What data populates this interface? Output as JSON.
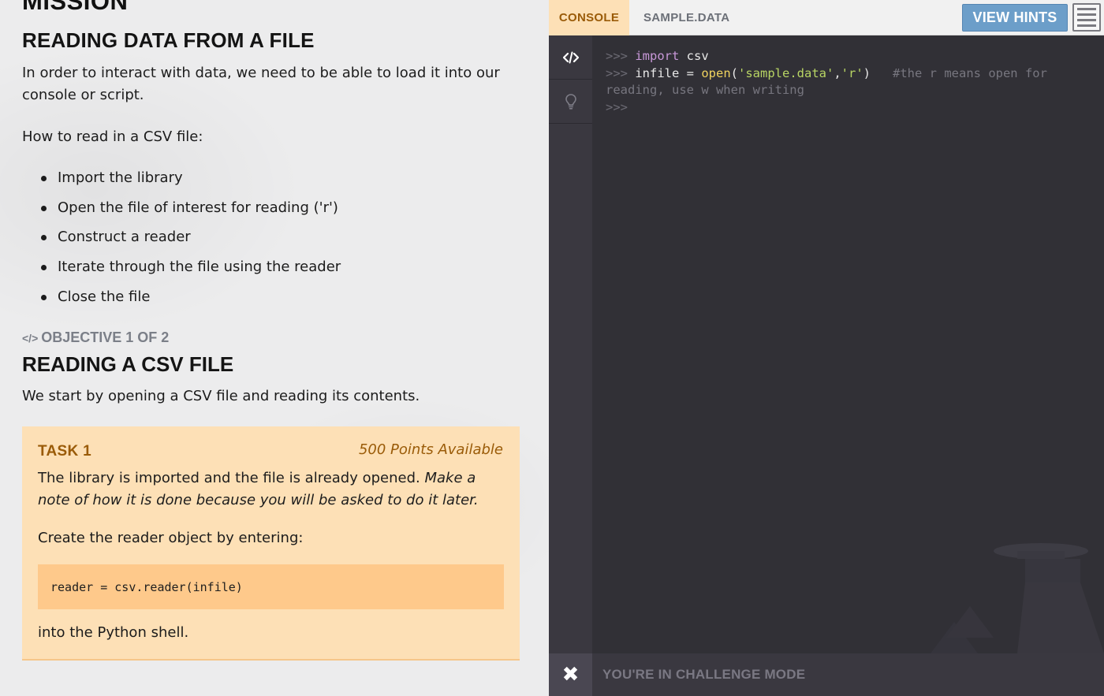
{
  "mission": {
    "heading": "MISSION",
    "section_title": "READING DATA FROM A FILE",
    "intro": "In order to interact with data, we need to be able to load it into our console or script.",
    "howto": "How to read in a CSV file:",
    "steps": [
      "Import the library",
      "Open the file of interest for reading ('r')",
      "Construct a reader",
      "Iterate through the file using the reader",
      "Close the file"
    ],
    "objective": {
      "label": "OBJECTIVE 1 OF 2",
      "title": "READING A CSV FILE",
      "description": "We start by opening a CSV file and reading its contents."
    },
    "task": {
      "label": "TASK 1",
      "points": "500 Points Available",
      "text_plain": "The library is imported and the file is already opened. ",
      "text_italic": "Make a note of how it is done because you will be asked to do it later.",
      "instruction": "Create the reader object by entering:",
      "code": "reader = csv.reader(infile)",
      "after": "into the Python shell."
    }
  },
  "editor": {
    "tabs": {
      "console": "CONSOLE",
      "sample": "SAMPLE.DATA"
    },
    "hints_label": "VIEW HINTS",
    "console_lines": {
      "line1_prompt": ">>> ",
      "line1_kw": "import",
      "line1_rest": " csv",
      "line2_prompt": ">>> ",
      "line2_a": "infile = ",
      "line2_fn": "open",
      "line2_b": "(",
      "line2_s1": "'sample.data'",
      "line2_c": ",",
      "line2_s2": "'r'",
      "line2_d": ")   ",
      "line2_comment": "#the r means open for reading, use w when writing",
      "line3_prompt": ">>>"
    },
    "challenge_text": "YOU'RE IN CHALLENGE MODE"
  },
  "colors": {
    "accent_orange": "#fde0b6",
    "accent_brown": "#9a5b08",
    "hint_blue": "#6c9ec9",
    "console_bg": "#313036"
  },
  "icons": {
    "gutter_code": "code-icon",
    "gutter_hint": "lightbulb-icon",
    "close": "close-icon",
    "menu": "menu-icon"
  }
}
